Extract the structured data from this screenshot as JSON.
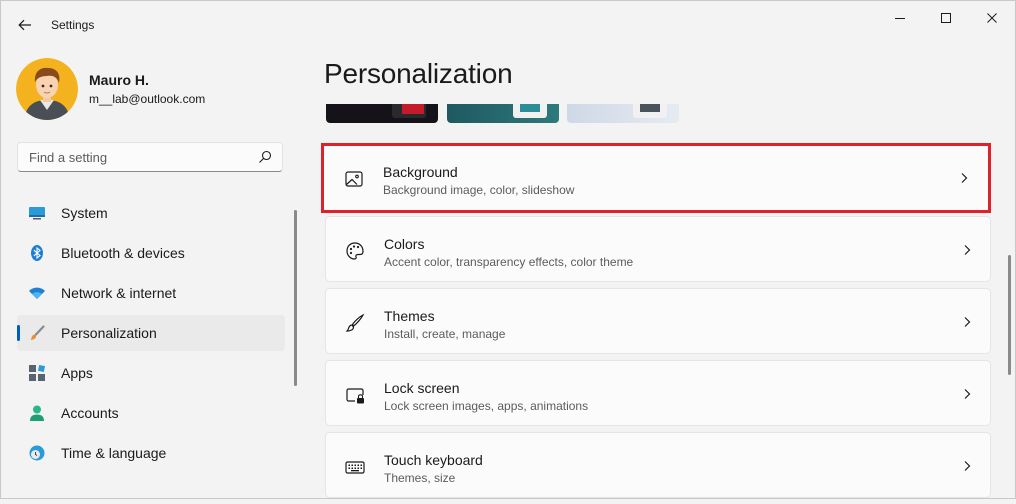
{
  "window": {
    "title": "Settings",
    "back_icon": "back-arrow-icon",
    "controls": [
      "minimize-icon",
      "maximize-icon",
      "close-icon"
    ]
  },
  "user": {
    "name": "Mauro H.",
    "email": "m__lab@outlook.com"
  },
  "search": {
    "placeholder": "Find a setting",
    "icon": "search-icon"
  },
  "nav": {
    "items": [
      {
        "label": "System",
        "icon": "system-monitor-icon"
      },
      {
        "label": "Bluetooth & devices",
        "icon": "bluetooth-icon"
      },
      {
        "label": "Network & internet",
        "icon": "wifi-icon"
      },
      {
        "label": "Personalization",
        "icon": "paintbrush-icon",
        "selected": true
      },
      {
        "label": "Apps",
        "icon": "apps-icon"
      },
      {
        "label": "Accounts",
        "icon": "accounts-icon"
      },
      {
        "label": "Time & language",
        "icon": "time-language-icon"
      }
    ]
  },
  "main": {
    "title": "Personalization",
    "cards": [
      {
        "title": "Background",
        "subtitle": "Background image, color, slideshow",
        "icon": "image-icon",
        "highlighted": true
      },
      {
        "title": "Colors",
        "subtitle": "Accent color, transparency effects, color theme",
        "icon": "palette-icon"
      },
      {
        "title": "Themes",
        "subtitle": "Install, create, manage",
        "icon": "brush-icon"
      },
      {
        "title": "Lock screen",
        "subtitle": "Lock screen images, apps, animations",
        "icon": "lock-screen-icon"
      },
      {
        "title": "Touch keyboard",
        "subtitle": "Themes, size",
        "icon": "keyboard-icon"
      }
    ]
  },
  "colors": {
    "accent": "#005fb8",
    "highlight_border": "#e0202b",
    "window_bg": "#f3f3f3",
    "card_bg": "#fbfbfb"
  }
}
